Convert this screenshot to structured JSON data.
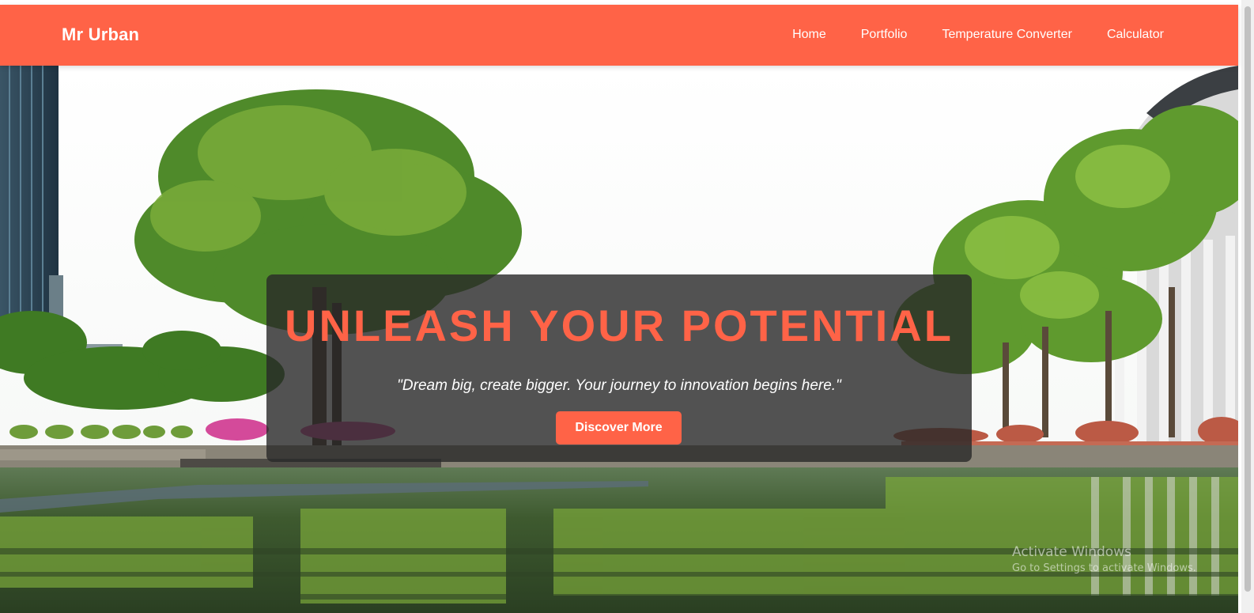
{
  "navbar": {
    "brand": "Mr Urban",
    "links": [
      {
        "label": "Home"
      },
      {
        "label": "Portfolio"
      },
      {
        "label": "Temperature Converter"
      },
      {
        "label": "Calculator"
      }
    ]
  },
  "hero": {
    "headline": "UNLEASH YOUR POTENTIAL",
    "tagline": "\"Dream big, create bigger. Your journey to innovation begins here.\"",
    "cta_label": "Discover More"
  },
  "watermark": {
    "title": "Activate Windows",
    "subtitle": "Go to Settings to activate Windows."
  },
  "colors": {
    "accent": "#ff6347",
    "overlay": "#282828"
  }
}
